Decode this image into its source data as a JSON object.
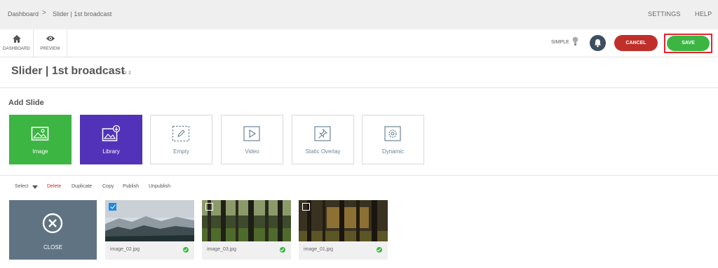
{
  "breadcrumb": {
    "home": "Dashboard",
    "separator": ">",
    "current": "Slider | 1st broadcast"
  },
  "top_links": {
    "settings": "SETTINGS",
    "help": "HELP"
  },
  "toolbar": {
    "dashboard_label": "DASHBOARD",
    "preview_label": "PREVIEW",
    "simple_label": "SIMPLE",
    "cancel_label": "CANCEL",
    "save_label": "SAVE"
  },
  "page": {
    "title": "Slider | 1st broadcast",
    "id_label": "ID: 2"
  },
  "add_slide": {
    "heading": "Add Slide",
    "tiles": [
      {
        "label": "Image",
        "icon": "image-icon",
        "color": "#3db543"
      },
      {
        "label": "Library",
        "icon": "library-icon",
        "color": "#5232b9"
      },
      {
        "label": "Empty",
        "icon": "empty-icon"
      },
      {
        "label": "Video",
        "icon": "video-play-icon"
      },
      {
        "label": "Static Overlay",
        "icon": "pin-icon"
      },
      {
        "label": "Dynamic",
        "icon": "gear-icon"
      }
    ]
  },
  "actions": {
    "select": "Select",
    "delete": "Delete",
    "duplicate": "Duplicate",
    "copy": "Copy",
    "publish": "Publish",
    "unpublish": "Unpublish"
  },
  "close_card": {
    "label": "CLOSE"
  },
  "slides": [
    {
      "filename": "image_02.jpg",
      "checked": true,
      "status": "published"
    },
    {
      "filename": "image_03.jpg",
      "checked": false,
      "status": "published"
    },
    {
      "filename": "image_01.jpg",
      "checked": false,
      "status": "published"
    }
  ],
  "colors": {
    "accent_green": "#3db543",
    "cancel_red": "#c0302b",
    "library_purple": "#5232b9",
    "close_card": "#607383",
    "highlight_frame": "#e0252b"
  }
}
